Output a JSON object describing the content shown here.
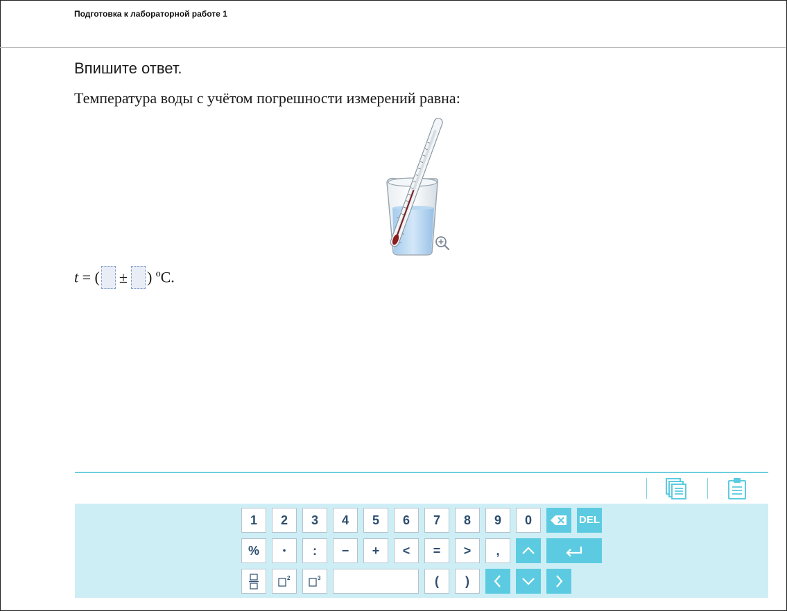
{
  "header": {
    "title": "Подготовка к лабораторной работе 1"
  },
  "task": {
    "instruction": "Впишите ответ.",
    "question": "Температура воды с учётом погрешности измерений равна:",
    "image_description": "",
    "formula": {
      "var": "t",
      "equals": " = (",
      "pm": "±",
      "unit": ") ºC."
    }
  },
  "toolbar": {
    "copy_icon": "copy-pages-icon",
    "clipboard_icon": "clipboard-icon"
  },
  "keyboard": {
    "row1": [
      "1",
      "2",
      "3",
      "4",
      "5",
      "6",
      "7",
      "8",
      "9",
      "0"
    ],
    "del_label": "DEL",
    "row2": [
      "%",
      "•",
      ":",
      "−",
      "+",
      "<",
      "=",
      ">",
      ","
    ],
    "row3": [
      "(",
      ")"
    ]
  },
  "colors": {
    "accent": "#5ccbe1",
    "keyboard_bg": "#ceeef6",
    "key_text": "#2c4d6e"
  }
}
